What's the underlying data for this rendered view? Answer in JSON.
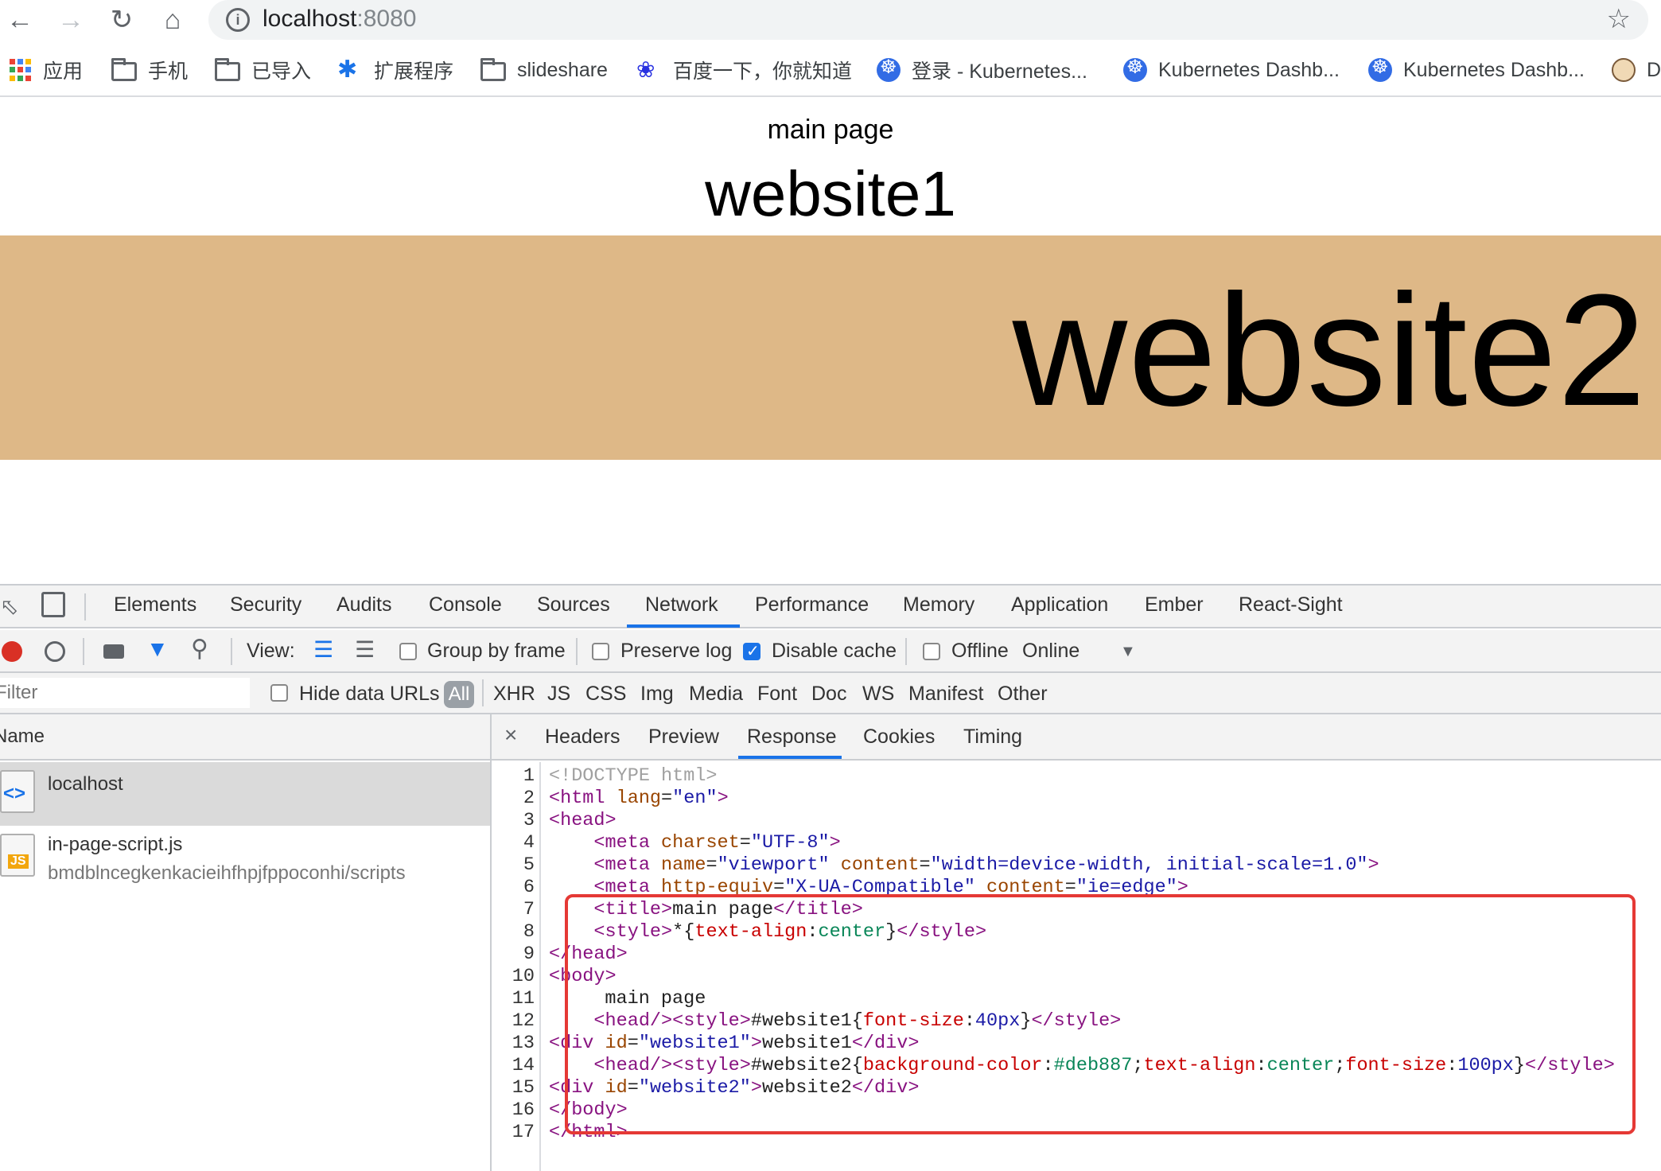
{
  "browser": {
    "url_host": "localhost",
    "url_port": ":8080",
    "bookmarks": [
      {
        "label": "应用",
        "icon": "apps-grid-icon"
      },
      {
        "label": "手机",
        "icon": "folder-icon"
      },
      {
        "label": "已导入",
        "icon": "folder-icon"
      },
      {
        "label": "扩展程序",
        "icon": "puzzle-icon"
      },
      {
        "label": "slideshare",
        "icon": "folder-icon"
      },
      {
        "label": "百度一下，你就知道",
        "icon": "baidu-paw-icon"
      },
      {
        "label": "登录 - Kubernetes...",
        "icon": "kubernetes-icon"
      },
      {
        "label": "Kubernetes Dashb...",
        "icon": "kubernetes-icon"
      },
      {
        "label": "Kubernetes Dashb...",
        "icon": "kubernetes-icon"
      },
      {
        "label": "D",
        "icon": "avatar-icon"
      }
    ]
  },
  "page": {
    "main_text": "main page",
    "website1": "website1",
    "website2": "website2",
    "website2_bg": "#deb887"
  },
  "devtools": {
    "tabs": [
      "Elements",
      "Security",
      "Audits",
      "Console",
      "Sources",
      "Network",
      "Performance",
      "Memory",
      "Application",
      "Ember",
      "React-Sight"
    ],
    "active_tab": "Network",
    "toolbar": {
      "view_label": "View:",
      "group_by_frame": "Group by frame",
      "preserve_log": "Preserve log",
      "disable_cache": "Disable cache",
      "offline": "Offline",
      "throttle": "Online"
    },
    "filter": {
      "placeholder": "Filter",
      "hide_data_urls": "Hide data URLs",
      "all": "All",
      "types": [
        "XHR",
        "JS",
        "CSS",
        "Img",
        "Media",
        "Font",
        "Doc",
        "WS",
        "Manifest",
        "Other"
      ]
    },
    "requests_header": "Name",
    "requests": [
      {
        "name": "localhost",
        "sub": ""
      },
      {
        "name": "in-page-script.js",
        "sub": "bmdblncegkenkacieihfhpjfppoconhi/scripts"
      }
    ],
    "detail_tabs": [
      "Headers",
      "Preview",
      "Response",
      "Cookies",
      "Timing"
    ],
    "active_detail_tab": "Response",
    "close_symbol": "×"
  },
  "code": {
    "line_numbers": [
      "1",
      "2",
      "3",
      "4",
      "5",
      "6",
      "7",
      "8",
      "9",
      "10",
      "11",
      "12",
      "13",
      "14",
      "15",
      "16",
      "17"
    ],
    "l1": "<!DOCTYPE html>",
    "l2_tag_open": "<html ",
    "l2_attr": "lang",
    "l2_eq": "=",
    "l2_val": "\"en\"",
    "l2_close": ">",
    "l3": "<head>",
    "l4_tag": "<meta ",
    "l4_attr": "charset",
    "l4_val": "\"UTF-8\"",
    "l4_close": ">",
    "l5_tag": "<meta ",
    "l5_attr1": "name",
    "l5_val1": "\"viewport\"",
    "l5_attr2": "content",
    "l5_val2": "\"width=device-width, initial-scale=1.0\"",
    "l5_close": ">",
    "l6_tag": "<meta ",
    "l6_attr1": "http-equiv",
    "l6_val1": "\"X-UA-Compatible\"",
    "l6_attr2": "content",
    "l6_val2": "\"ie=edge\"",
    "l6_close": ">",
    "l7_open": "<title>",
    "l7_text": "main page",
    "l7_close": "</title>",
    "l8_open": "<style>",
    "l8_sel": "*{",
    "l8_prop": "text-align",
    "l8_colon": ":",
    "l8_val": "center",
    "l8_end": "}",
    "l8_close": "</style>",
    "l9": "</head>",
    "l10": "<body>",
    "l11": "main page",
    "l12_open": "<head/><style>",
    "l12_sel": "#website1{",
    "l12_prop": "font-size",
    "l12_val": "40px",
    "l12_end": "}",
    "l12_close": "</style>",
    "l13_open": "<div ",
    "l13_attr": "id",
    "l13_val": "\"website1\"",
    "l13_gt": ">",
    "l13_text": "website1",
    "l13_close": "</div>",
    "l14_open": "<head/><style>",
    "l14_sel": "#website2{",
    "l14_p1": "background-color",
    "l14_v1": "#deb887",
    "l14_p2": "text-align",
    "l14_v2": "center",
    "l14_p3": "font-size",
    "l14_v3": "100px",
    "l14_end": "}",
    "l14_close": "</style>",
    "l15_open": "<div ",
    "l15_attr": "id",
    "l15_val": "\"website2\"",
    "l15_gt": ">",
    "l15_text": "website2",
    "l15_close": "</div>",
    "l16": "</body>",
    "l17": "</html>"
  }
}
